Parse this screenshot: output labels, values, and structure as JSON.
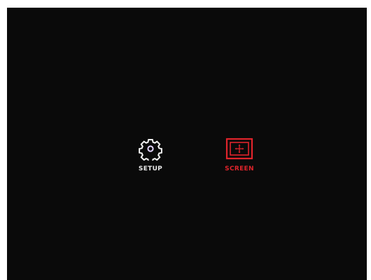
{
  "menu": {
    "items": [
      {
        "label": "SETUP",
        "icon": "gear-icon",
        "selected": false,
        "color": "#e9e9e9"
      },
      {
        "label": "SCREEN",
        "icon": "screen-position-icon",
        "selected": true,
        "color": "#e0242b"
      }
    ]
  },
  "colors": {
    "background": "#0a0a0a",
    "selected_accent": "#e0242b",
    "text": "#e9e9e9"
  }
}
